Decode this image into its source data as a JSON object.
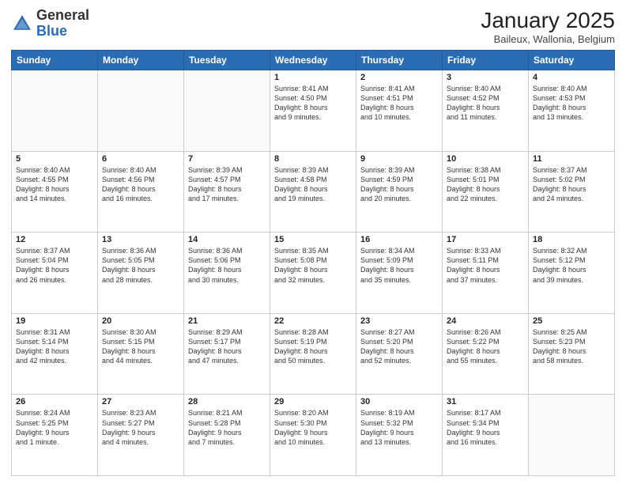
{
  "header": {
    "logo_general": "General",
    "logo_blue": "Blue",
    "title": "January 2025",
    "subtitle": "Baileux, Wallonia, Belgium"
  },
  "days_of_week": [
    "Sunday",
    "Monday",
    "Tuesday",
    "Wednesday",
    "Thursday",
    "Friday",
    "Saturday"
  ],
  "weeks": [
    [
      {
        "day": "",
        "info": ""
      },
      {
        "day": "",
        "info": ""
      },
      {
        "day": "",
        "info": ""
      },
      {
        "day": "1",
        "info": "Sunrise: 8:41 AM\nSunset: 4:50 PM\nDaylight: 8 hours\nand 9 minutes."
      },
      {
        "day": "2",
        "info": "Sunrise: 8:41 AM\nSunset: 4:51 PM\nDaylight: 8 hours\nand 10 minutes."
      },
      {
        "day": "3",
        "info": "Sunrise: 8:40 AM\nSunset: 4:52 PM\nDaylight: 8 hours\nand 11 minutes."
      },
      {
        "day": "4",
        "info": "Sunrise: 8:40 AM\nSunset: 4:53 PM\nDaylight: 8 hours\nand 13 minutes."
      }
    ],
    [
      {
        "day": "5",
        "info": "Sunrise: 8:40 AM\nSunset: 4:55 PM\nDaylight: 8 hours\nand 14 minutes."
      },
      {
        "day": "6",
        "info": "Sunrise: 8:40 AM\nSunset: 4:56 PM\nDaylight: 8 hours\nand 16 minutes."
      },
      {
        "day": "7",
        "info": "Sunrise: 8:39 AM\nSunset: 4:57 PM\nDaylight: 8 hours\nand 17 minutes."
      },
      {
        "day": "8",
        "info": "Sunrise: 8:39 AM\nSunset: 4:58 PM\nDaylight: 8 hours\nand 19 minutes."
      },
      {
        "day": "9",
        "info": "Sunrise: 8:39 AM\nSunset: 4:59 PM\nDaylight: 8 hours\nand 20 minutes."
      },
      {
        "day": "10",
        "info": "Sunrise: 8:38 AM\nSunset: 5:01 PM\nDaylight: 8 hours\nand 22 minutes."
      },
      {
        "day": "11",
        "info": "Sunrise: 8:37 AM\nSunset: 5:02 PM\nDaylight: 8 hours\nand 24 minutes."
      }
    ],
    [
      {
        "day": "12",
        "info": "Sunrise: 8:37 AM\nSunset: 5:04 PM\nDaylight: 8 hours\nand 26 minutes."
      },
      {
        "day": "13",
        "info": "Sunrise: 8:36 AM\nSunset: 5:05 PM\nDaylight: 8 hours\nand 28 minutes."
      },
      {
        "day": "14",
        "info": "Sunrise: 8:36 AM\nSunset: 5:06 PM\nDaylight: 8 hours\nand 30 minutes."
      },
      {
        "day": "15",
        "info": "Sunrise: 8:35 AM\nSunset: 5:08 PM\nDaylight: 8 hours\nand 32 minutes."
      },
      {
        "day": "16",
        "info": "Sunrise: 8:34 AM\nSunset: 5:09 PM\nDaylight: 8 hours\nand 35 minutes."
      },
      {
        "day": "17",
        "info": "Sunrise: 8:33 AM\nSunset: 5:11 PM\nDaylight: 8 hours\nand 37 minutes."
      },
      {
        "day": "18",
        "info": "Sunrise: 8:32 AM\nSunset: 5:12 PM\nDaylight: 8 hours\nand 39 minutes."
      }
    ],
    [
      {
        "day": "19",
        "info": "Sunrise: 8:31 AM\nSunset: 5:14 PM\nDaylight: 8 hours\nand 42 minutes."
      },
      {
        "day": "20",
        "info": "Sunrise: 8:30 AM\nSunset: 5:15 PM\nDaylight: 8 hours\nand 44 minutes."
      },
      {
        "day": "21",
        "info": "Sunrise: 8:29 AM\nSunset: 5:17 PM\nDaylight: 8 hours\nand 47 minutes."
      },
      {
        "day": "22",
        "info": "Sunrise: 8:28 AM\nSunset: 5:19 PM\nDaylight: 8 hours\nand 50 minutes."
      },
      {
        "day": "23",
        "info": "Sunrise: 8:27 AM\nSunset: 5:20 PM\nDaylight: 8 hours\nand 52 minutes."
      },
      {
        "day": "24",
        "info": "Sunrise: 8:26 AM\nSunset: 5:22 PM\nDaylight: 8 hours\nand 55 minutes."
      },
      {
        "day": "25",
        "info": "Sunrise: 8:25 AM\nSunset: 5:23 PM\nDaylight: 8 hours\nand 58 minutes."
      }
    ],
    [
      {
        "day": "26",
        "info": "Sunrise: 8:24 AM\nSunset: 5:25 PM\nDaylight: 9 hours\nand 1 minute."
      },
      {
        "day": "27",
        "info": "Sunrise: 8:23 AM\nSunset: 5:27 PM\nDaylight: 9 hours\nand 4 minutes."
      },
      {
        "day": "28",
        "info": "Sunrise: 8:21 AM\nSunset: 5:28 PM\nDaylight: 9 hours\nand 7 minutes."
      },
      {
        "day": "29",
        "info": "Sunrise: 8:20 AM\nSunset: 5:30 PM\nDaylight: 9 hours\nand 10 minutes."
      },
      {
        "day": "30",
        "info": "Sunrise: 8:19 AM\nSunset: 5:32 PM\nDaylight: 9 hours\nand 13 minutes."
      },
      {
        "day": "31",
        "info": "Sunrise: 8:17 AM\nSunset: 5:34 PM\nDaylight: 9 hours\nand 16 minutes."
      },
      {
        "day": "",
        "info": ""
      }
    ]
  ]
}
